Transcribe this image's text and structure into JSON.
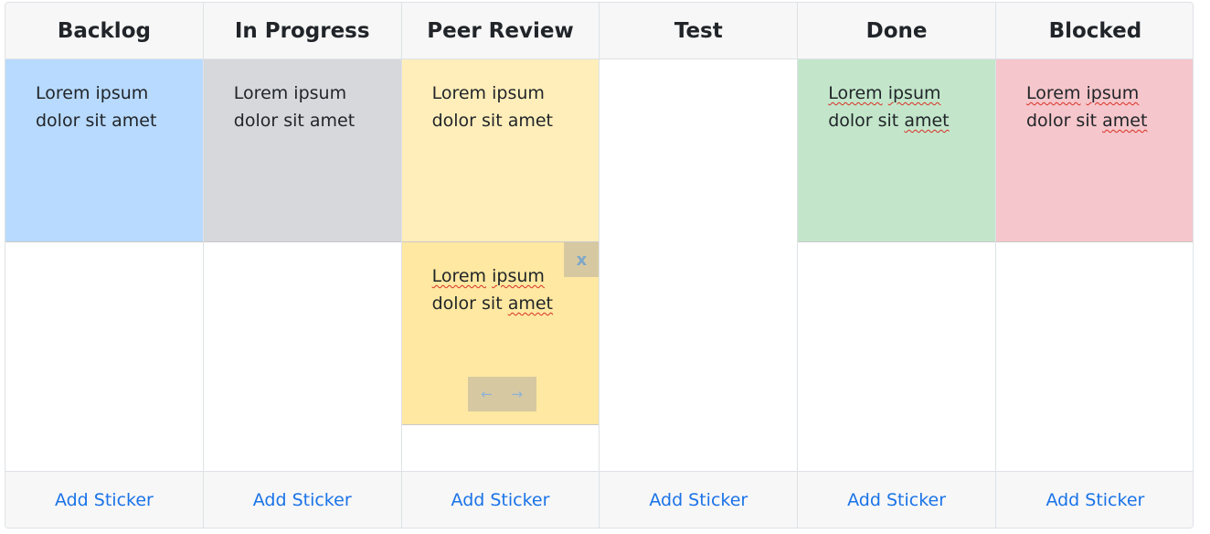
{
  "columns": [
    {
      "title": "Backlog",
      "add_label": "Add Sticker"
    },
    {
      "title": "In Progress",
      "add_label": "Add Sticker"
    },
    {
      "title": "Peer Review",
      "add_label": "Add Sticker"
    },
    {
      "title": "Test",
      "add_label": "Add Sticker"
    },
    {
      "title": "Done",
      "add_label": "Add Sticker"
    },
    {
      "title": "Blocked",
      "add_label": "Add Sticker"
    }
  ],
  "stickers": {
    "backlog_1": {
      "line1": "Lorem ipsum",
      "line2": "dolor sit amet",
      "color": "#b8daff"
    },
    "in_progress_1": {
      "line1": "Lorem ipsum",
      "line2": "dolor sit amet",
      "color": "#d6d8db"
    },
    "peer_review_1": {
      "line1": "Lorem ipsum",
      "line2": "dolor sit amet",
      "color": "#ffeeba"
    },
    "peer_review_2": {
      "line1_a": "Lorem",
      "line1_b": "ipsum",
      "line2_a": "dolor sit",
      "line2_b": "amet",
      "color": "#ffe8a1"
    },
    "done_1": {
      "line1_a": "Lorem",
      "line1_b": "ipsum",
      "line2_a": "dolor sit",
      "line2_b": "amet",
      "color": "#c3e6cb"
    },
    "blocked_1": {
      "line1_a": "Lorem",
      "line1_b": "ipsum",
      "line2_a": "dolor sit",
      "line2_b": "amet",
      "color": "#f5c6cb"
    }
  },
  "controls": {
    "close_glyph": "x",
    "left_arrow": "←",
    "right_arrow": "→"
  }
}
